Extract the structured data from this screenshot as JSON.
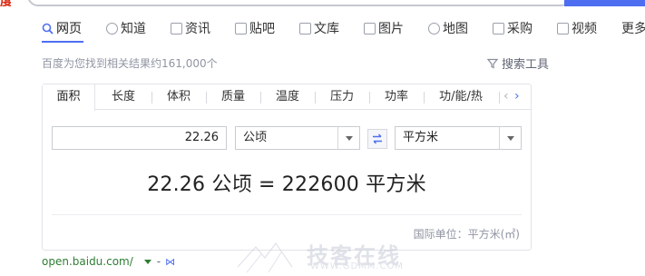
{
  "nav": {
    "items": [
      {
        "label": "网页",
        "icon": "search-icon",
        "active": true
      },
      {
        "label": "知道",
        "icon": "question-icon"
      },
      {
        "label": "资讯",
        "icon": "news-icon"
      },
      {
        "label": "贴吧",
        "icon": "tieba-icon"
      },
      {
        "label": "文库",
        "icon": "document-icon"
      },
      {
        "label": "图片",
        "icon": "image-icon"
      },
      {
        "label": "地图",
        "icon": "map-pin-icon"
      },
      {
        "label": "采购",
        "icon": "basket-icon"
      },
      {
        "label": "视频",
        "icon": "play-icon"
      },
      {
        "label": "更多",
        "icon": ""
      }
    ]
  },
  "results": {
    "count_text": "百度为您找到相关结果约161,000个",
    "tools_label": "搜索工具"
  },
  "converter": {
    "tabs": [
      "面积",
      "长度",
      "体积",
      "质量",
      "温度",
      "压力",
      "功率",
      "功/能/热"
    ],
    "active_tab": "面积",
    "input_value": "22.26",
    "from_unit": "公顷",
    "to_unit": "平方米",
    "result_text": "22.26 公顷 = 222600 平方米",
    "intl_unit_text": "国际单位：平方米(㎡)"
  },
  "source": {
    "url": "open.baidu.com/",
    "separator": "-"
  },
  "watermark": {
    "brand": "技客在线",
    "url": "WWW.GDMM.COM"
  },
  "colors": {
    "accent": "#4e6ef2",
    "source_green": "#2e7d32",
    "muted": "#9195a3"
  }
}
